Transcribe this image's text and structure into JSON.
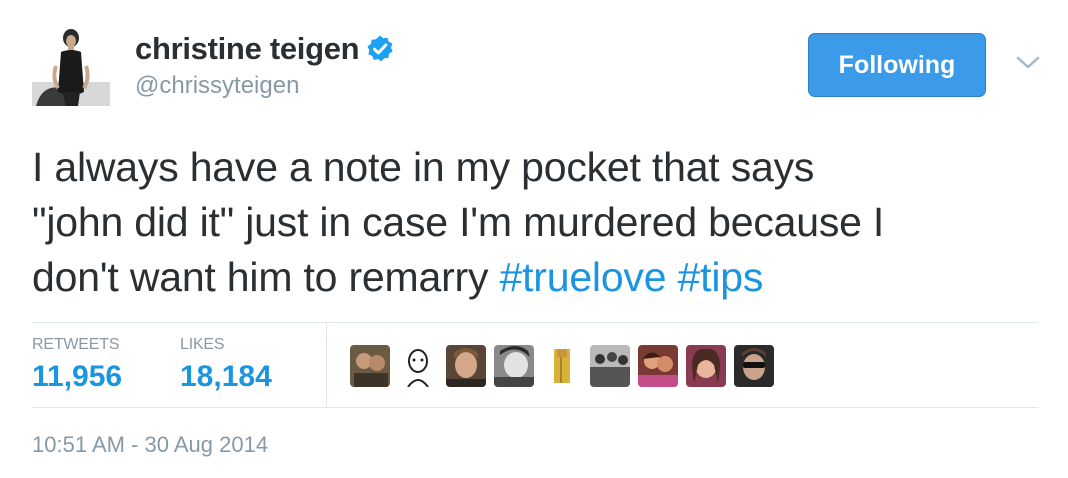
{
  "user": {
    "display_name": "christine teigen",
    "handle": "@chrissyteigen"
  },
  "follow_button": {
    "label": "Following"
  },
  "tweet": {
    "text_line1": "I always have a note in my pocket that says",
    "text_line2": "\"john did it\" just in case I'm murdered because I",
    "text_line3_prefix": "don't want him to remarry ",
    "hashtags": [
      "#truelove",
      "#tips"
    ],
    "timestamp": "10:51 AM - 30 Aug 2014"
  },
  "stats": {
    "retweets_label": "RETWEETS",
    "retweets_value": "11,956",
    "likes_label": "LIKES",
    "likes_value": "18,184"
  },
  "colors": {
    "accent": "#1b95e0",
    "button": "#3b9be8",
    "muted": "#8899a6",
    "text": "#292f33",
    "border": "#e1e8ed"
  },
  "icons": {
    "verified": "verified-badge-icon",
    "caret": "chevron-down-icon"
  }
}
